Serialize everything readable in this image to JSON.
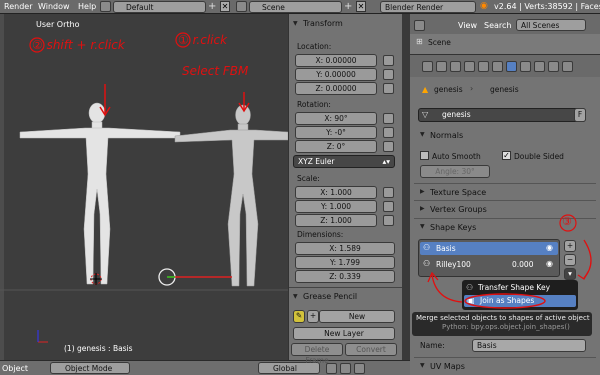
{
  "menu": {
    "items": [
      "Render",
      "Window",
      "Help"
    ],
    "layout": "Default",
    "scene": "Scene",
    "engine": "Blender Render",
    "version": "v2.64 | Verts:38592 | Faces:3"
  },
  "viewport": {
    "title": "User Ortho",
    "status": "(1) genesis : Basis",
    "mode": "Object Mode",
    "orientation": "Global"
  },
  "annotations": {
    "a1": "② shift + r.click",
    "a2": "① r.click",
    "a3": "Select FBM",
    "a4": "③"
  },
  "transform": {
    "header": "Transform",
    "location_label": "Location:",
    "loc": [
      "X: 0.00000",
      "Y: 0.00000",
      "Z: 0.00000"
    ],
    "rotation_label": "Rotation:",
    "rot": [
      "X: 90°",
      "Y: -0°",
      "Z: 0°"
    ],
    "rot_mode": "XYZ Euler",
    "scale_label": "Scale:",
    "scale": [
      "X: 1.000",
      "Y: 1.000",
      "Z: 1.000"
    ],
    "dim_label": "Dimensions:",
    "dim": [
      "X: 1.589",
      "Y: 1.799",
      "Z: 0.339"
    ]
  },
  "grease": {
    "header": "Grease Pencil",
    "new": "New",
    "new_layer": "New Layer",
    "delete_frame": "Delete Frame",
    "convert": "Convert"
  },
  "outliner": {
    "view": "View",
    "search": "Search",
    "all_scenes": "All Scenes",
    "scene": "Scene"
  },
  "properties": {
    "crumb1": "genesis",
    "crumb2": "genesis",
    "mesh_name": "genesis",
    "f": "F",
    "normals": "Normals",
    "auto_smooth": "Auto Smooth",
    "double_sided": "Double Sided",
    "angle": "Angle: 30°",
    "texture_space": "Texture Space",
    "vertex_groups": "Vertex Groups",
    "shape_keys": "Shape Keys",
    "keys": [
      {
        "name": "Basis",
        "value": ""
      },
      {
        "name": "Rilley100",
        "value": "0.000"
      }
    ],
    "name_label": "Name:",
    "name_value": "Basis",
    "uv_maps": "UV Maps"
  },
  "popup": {
    "items": [
      "Transfer Shape Key",
      "Join as Shapes"
    ],
    "tooltip": "Merge selected objects to shapes of active object",
    "tooltip_python": "Python: bpy.ops.object.join_shapes()"
  },
  "colors": {
    "annotation": "#e01010",
    "highlight": "#5680c2",
    "viewport": "#3d3d3d"
  }
}
